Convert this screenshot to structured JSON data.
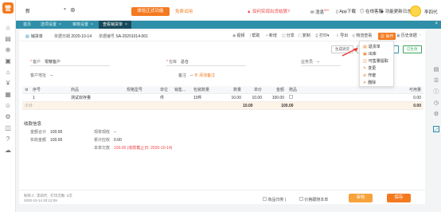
{
  "app": {
    "logo_text": "管"
  },
  "topbar": {
    "store": "新",
    "trial_button": "体验正式功能",
    "trial_link": "免费试用",
    "notice": "如何实现出货结算?",
    "items": [
      {
        "label": "消息",
        "badge": "99+"
      },
      {
        "label": "App下载"
      },
      {
        "label": "在线客服"
      },
      {
        "label": "功能更新日志"
      }
    ],
    "user": "李四代"
  },
  "tabs": [
    {
      "label": "首页",
      "closable": false
    },
    {
      "label": "选项设置",
      "closable": true
    },
    {
      "label": "审核设置",
      "closable": true
    },
    {
      "label": "查看销货单",
      "closable": true,
      "active": true
    }
  ],
  "doc": {
    "type_label": "销货单",
    "date_label": "单据日期",
    "date": "2020-10-14",
    "no_label": "单据编号",
    "no": "SA-20201014-001"
  },
  "toolbar": [
    "视频",
    "帮助",
    "新增",
    "分享",
    "复制",
    "打印",
    "导出",
    "物流查看"
  ],
  "toolbar_active": "操作",
  "toolbar_tail": "历史单据",
  "subtools": [
    "生成退货",
    "未出库",
    "已出库",
    "已生效"
  ],
  "fields": {
    "customer_label": "客户",
    "customer_value": "零散客户",
    "address_label": "客户地址",
    "address_value": "--",
    "warehouse_label": "仓库",
    "warehouse_value": "总仓",
    "salesman_label": "业务员",
    "salesman_value": "--",
    "remark_label": "备注",
    "remark_value": "--",
    "add_remark": "添加备注"
  },
  "table": {
    "headers": [
      "",
      "序号",
      "商品",
      "规格型号",
      "单位",
      "销售...",
      "包装数量",
      "数量",
      "单价",
      "金额",
      "赠品",
      "",
      "",
      "可用量"
    ],
    "rows": [
      {
        "seq": "1",
        "product": "测试双存量",
        "spec": "",
        "unit": "件",
        "pkg": "10件",
        "qty": "10.00",
        "price": "10.00",
        "amount": "100.00",
        "gift": "",
        "avail": "0.00"
      }
    ],
    "subtotal": {
      "label": "小计",
      "qty": "10.00",
      "amount": "100.00",
      "avail": "0.00"
    }
  },
  "summary": {
    "title": "收款信息",
    "total_label": "金额合计",
    "total": "100.00",
    "paid_label": "实收金额",
    "paid": "100.00",
    "discount_label": "现单现收",
    "discount": "--",
    "pay_label": "累计应收",
    "pay": "0.00",
    "receivable_label": "本单欠款",
    "receivable": "100.00",
    "receivable_note": "(收款截止日: 2020-10-14)"
  },
  "dropdown": [
    "退货单",
    "出库",
    "可售量提取",
    "变更",
    "作废",
    "删除"
  ],
  "footer": {
    "maker": "制单人: 李四代",
    "print_count": "打印次数: 0次",
    "time": "2020-10-14 20:12:09",
    "chk1": "商品归类",
    "chk2": "价格跟随本单",
    "btn_audit": "审核",
    "btn_save": "保存"
  },
  "colors": {
    "brand": "#f47a20",
    "tab_bar": "#2f8fa8",
    "active_tab": "#17495a"
  }
}
